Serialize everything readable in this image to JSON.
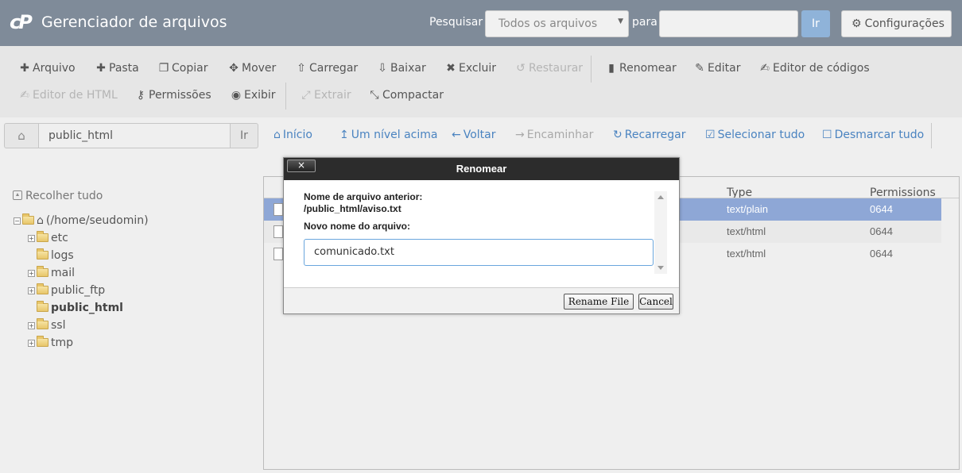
{
  "header": {
    "title": "Gerenciador de arquivos",
    "search_label": "Pesquisar",
    "search_scope": "Todos os arquivos",
    "para_label": "para",
    "search_value": "",
    "go_label": "Ir",
    "settings_label": "Configurações",
    "accent_color": "#8fb3d9"
  },
  "toolbar": {
    "row1": [
      "Arquivo",
      "Pasta",
      "Copiar",
      "Mover",
      "Carregar",
      "Baixar",
      "Excluir",
      "Restaurar",
      "Renomear",
      "Editar",
      "Editor de códigos"
    ],
    "row2": [
      "Editor de HTML",
      "Permissões",
      "Exibir",
      "Extrair",
      "Compactar"
    ]
  },
  "pathbar": {
    "path": "public_html",
    "go_label": "Ir",
    "nav": [
      "Início",
      "Um nível acima",
      "Voltar",
      "Encaminhar",
      "Recarregar",
      "Selecionar tudo",
      "Desmarcar tudo"
    ]
  },
  "tree": {
    "collapse_all": "Recolher tudo",
    "root": "(/home/seudomin)",
    "items": [
      "etc",
      "logs",
      "mail",
      "public_ftp",
      "public_html",
      "ssl",
      "tmp"
    ]
  },
  "table": {
    "headers": {
      "type": "Type",
      "permissions": "Permissions"
    },
    "rows": [
      {
        "type": "text/plain",
        "permissions": "0644",
        "selected": true
      },
      {
        "type": "text/html",
        "permissions": "0644",
        "selected": false
      },
      {
        "type": "text/html",
        "permissions": "0644",
        "selected": false
      }
    ],
    "selected_color": "#8ea7d6"
  },
  "modal": {
    "title": "Renomear",
    "close_label": "×",
    "old_name_label": "Nome de arquivo anterior:",
    "old_name_value": "/public_html/aviso.txt",
    "new_name_label": "Novo nome do arquivo:",
    "new_name_value": "comunicado.txt",
    "rename_button": "Rename File",
    "cancel_button": "Cancel"
  }
}
